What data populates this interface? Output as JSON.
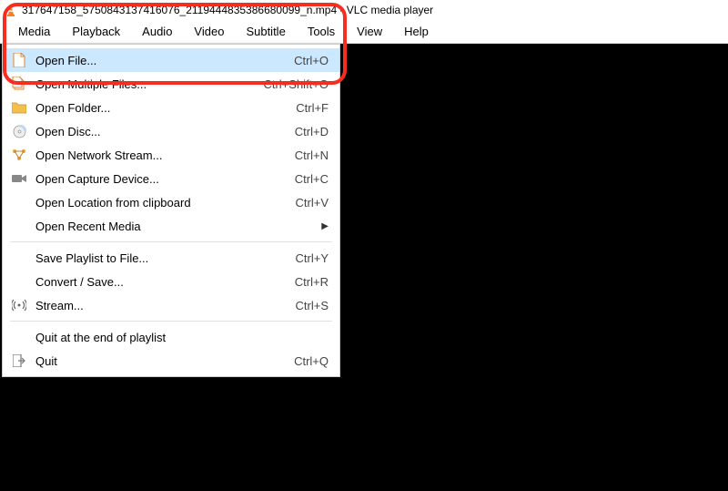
{
  "title": "317647158_5750843137416076_2119444835386680099_n.mp4 - VLC media player",
  "menubar": [
    "Media",
    "Playback",
    "Audio",
    "Video",
    "Subtitle",
    "Tools",
    "View",
    "Help"
  ],
  "dropdown": {
    "items": [
      {
        "icon": "file",
        "label": "Open File...",
        "shortcut": "Ctrl+O",
        "highlighted": true
      },
      {
        "icon": "files",
        "label": "Open Multiple Files...",
        "shortcut": "Ctrl+Shift+O"
      },
      {
        "icon": "folder",
        "label": "Open Folder...",
        "shortcut": "Ctrl+F"
      },
      {
        "icon": "disc",
        "label": "Open Disc...",
        "shortcut": "Ctrl+D"
      },
      {
        "icon": "network",
        "label": "Open Network Stream...",
        "shortcut": "Ctrl+N"
      },
      {
        "icon": "capture",
        "label": "Open Capture Device...",
        "shortcut": "Ctrl+C"
      },
      {
        "icon": "",
        "label": "Open Location from clipboard",
        "shortcut": "Ctrl+V"
      },
      {
        "icon": "",
        "label": "Open Recent Media",
        "submenu": true
      }
    ],
    "items2": [
      {
        "icon": "",
        "label": "Save Playlist to File...",
        "shortcut": "Ctrl+Y"
      },
      {
        "icon": "",
        "label": "Convert / Save...",
        "shortcut": "Ctrl+R"
      },
      {
        "icon": "stream",
        "label": "Stream...",
        "shortcut": "Ctrl+S"
      }
    ],
    "items3": [
      {
        "icon": "",
        "label": "Quit at the end of playlist",
        "shortcut": ""
      },
      {
        "icon": "quit",
        "label": "Quit",
        "shortcut": "Ctrl+Q"
      }
    ]
  }
}
